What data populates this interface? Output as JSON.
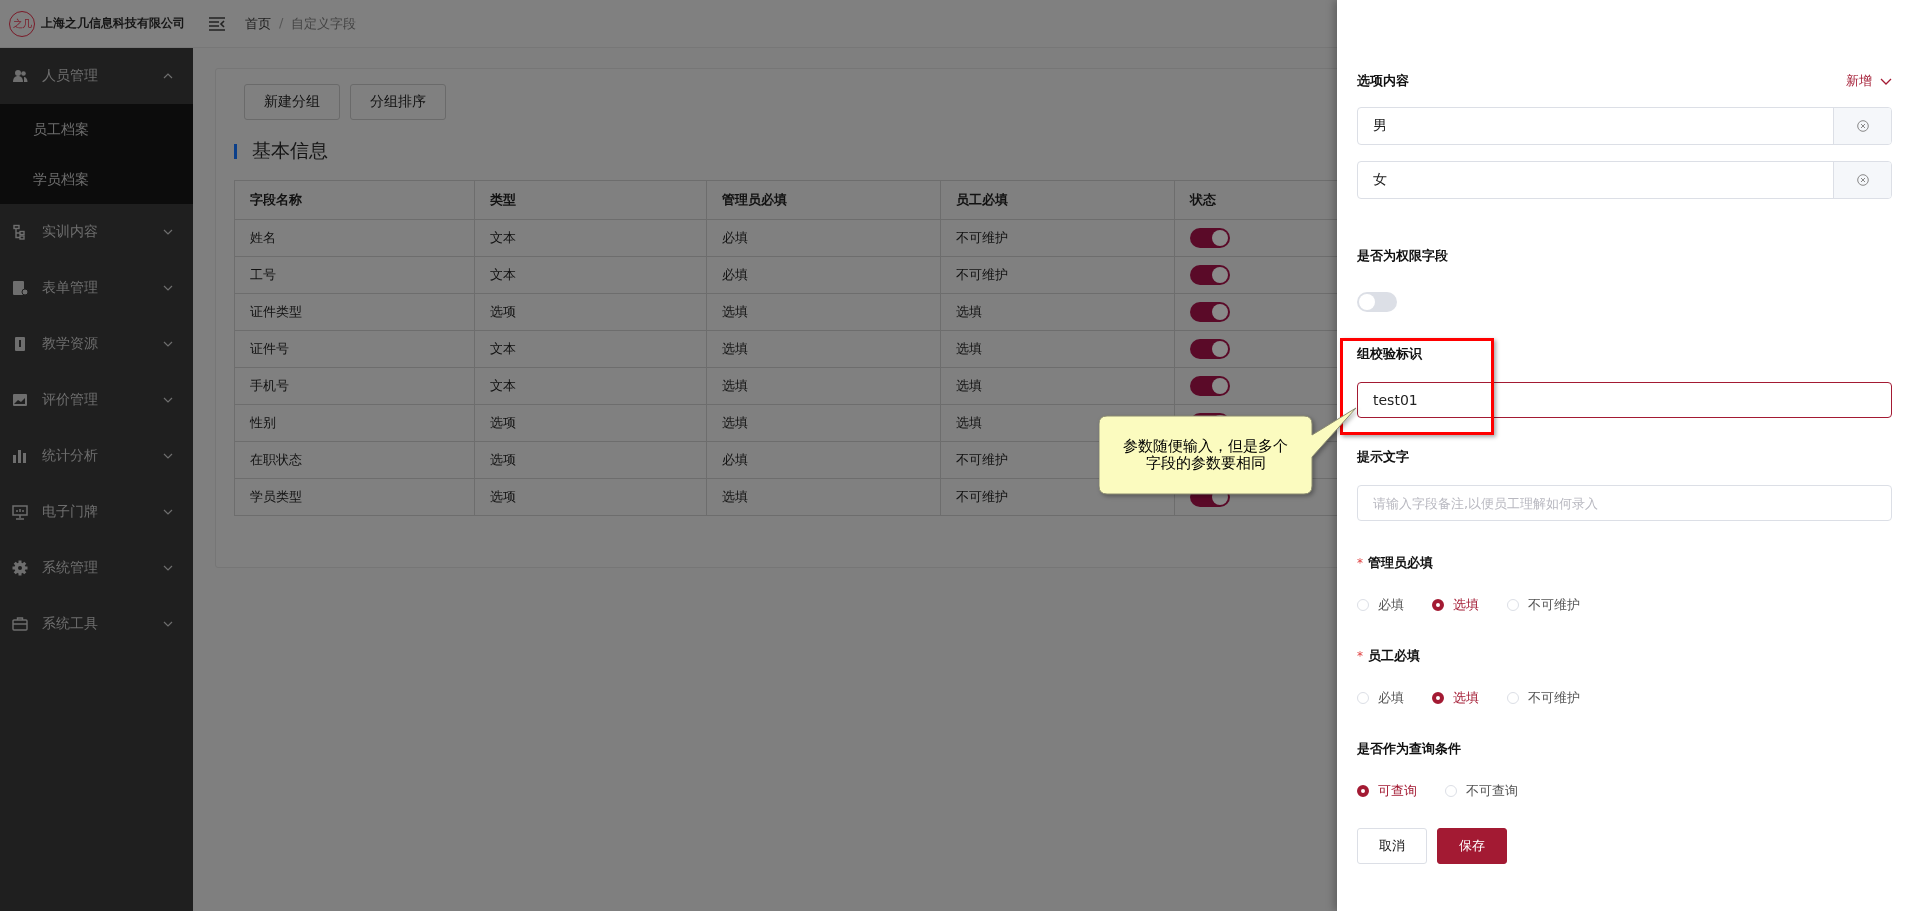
{
  "header": {
    "logo_text": "之几",
    "company": "上海之几信息科技有限公司",
    "breadcrumb": [
      "首页",
      "自定义字段"
    ],
    "breadcrumb_separator": "/"
  },
  "sidebar": {
    "items": [
      {
        "label": "人员管理",
        "expanded": true,
        "children": [
          {
            "label": "员工档案"
          },
          {
            "label": "学员档案"
          }
        ]
      },
      {
        "label": "实训内容",
        "expanded": false
      },
      {
        "label": "表单管理",
        "expanded": false
      },
      {
        "label": "教学资源",
        "expanded": false
      },
      {
        "label": "评价管理",
        "expanded": false
      },
      {
        "label": "统计分析",
        "expanded": false
      },
      {
        "label": "电子门牌",
        "expanded": false
      },
      {
        "label": "系统管理",
        "expanded": false
      },
      {
        "label": "系统工具",
        "expanded": false
      }
    ]
  },
  "content": {
    "buttons": [
      "新建分组",
      "分组排序"
    ],
    "section_title": "基本信息",
    "table": {
      "columns": [
        "字段名称",
        "类型",
        "管理员必填",
        "员工必填",
        "状态"
      ],
      "rows": [
        {
          "cells": [
            "姓名",
            "文本",
            "必填",
            "不可维护"
          ],
          "on": true
        },
        {
          "cells": [
            "工号",
            "文本",
            "必填",
            "不可维护"
          ],
          "on": true
        },
        {
          "cells": [
            "证件类型",
            "选项",
            "选填",
            "选填"
          ],
          "on": true
        },
        {
          "cells": [
            "证件号",
            "文本",
            "选填",
            "选填"
          ],
          "on": true
        },
        {
          "cells": [
            "手机号",
            "文本",
            "选填",
            "选填"
          ],
          "on": true
        },
        {
          "cells": [
            "性别",
            "选项",
            "选填",
            "选填"
          ],
          "on": true
        },
        {
          "cells": [
            "在职状态",
            "选项",
            "必填",
            "不可维护"
          ]
        },
        {
          "cells": [
            "学员类型",
            "选项",
            "选填",
            "不可维护"
          ],
          "on": true
        }
      ]
    }
  },
  "drawer": {
    "options_label": "选项内容",
    "add_label": "新增",
    "options": [
      {
        "value": "男"
      },
      {
        "value": "女"
      }
    ],
    "permission": {
      "label": "是否为权限字段",
      "on": false
    },
    "group_check": {
      "label": "组校验标识",
      "value": "test01",
      "focused": true
    },
    "hint": {
      "label": "提示文字",
      "placeholder": "请输入字段备注,以便员工理解如何录入"
    },
    "radio_groups": [
      {
        "label": "管理员必填",
        "required_mark": "*",
        "options": [
          {
            "label": "必填",
            "selected": false
          },
          {
            "label": "选填",
            "selected": true
          },
          {
            "label": "不可维护",
            "selected": false
          }
        ]
      },
      {
        "label": "员工必填",
        "required_mark": "*",
        "options": [
          {
            "label": "必填",
            "selected": false
          },
          {
            "label": "选填",
            "selected": true
          },
          {
            "label": "不可维护",
            "selected": false
          }
        ]
      },
      {
        "label": "是否作为查询条件",
        "options": [
          {
            "label": "可查询",
            "selected": true
          },
          {
            "label": "不可查询",
            "selected": false
          }
        ]
      }
    ],
    "actions": {
      "cancel": "取消",
      "save": "保存"
    }
  },
  "annotation": {
    "callout": "参数随便输入，但是多个字段的参数要相同"
  }
}
